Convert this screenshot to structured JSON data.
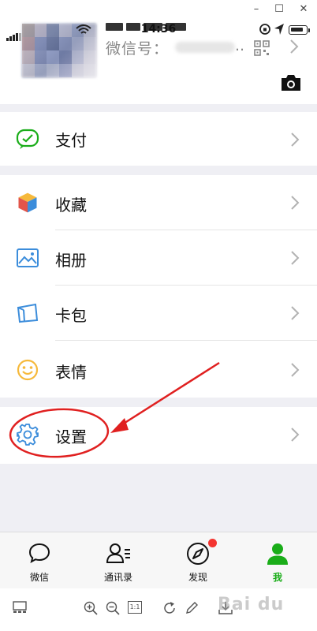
{
  "status_bar": {
    "time": "14:36"
  },
  "profile": {
    "wechat_id_label": "微信号：",
    "wechat_id_suffix": ".."
  },
  "menu": {
    "pay": "支付",
    "favorites": "收藏",
    "album": "相册",
    "cards": "卡包",
    "stickers": "表情",
    "settings": "设置"
  },
  "tabbar": {
    "items": [
      {
        "label": "微信",
        "icon": "chat-bubble-icon"
      },
      {
        "label": "通讯录",
        "icon": "contacts-icon"
      },
      {
        "label": "发现",
        "icon": "compass-icon"
      },
      {
        "label": "我",
        "icon": "person-icon"
      }
    ],
    "active_index": 3
  },
  "viewer_toolbar": {
    "actual_size_label": "1:1"
  },
  "colors": {
    "wechat_green": "#1aad19",
    "annotation_red": "#e02020",
    "badge_red": "#f43530"
  }
}
